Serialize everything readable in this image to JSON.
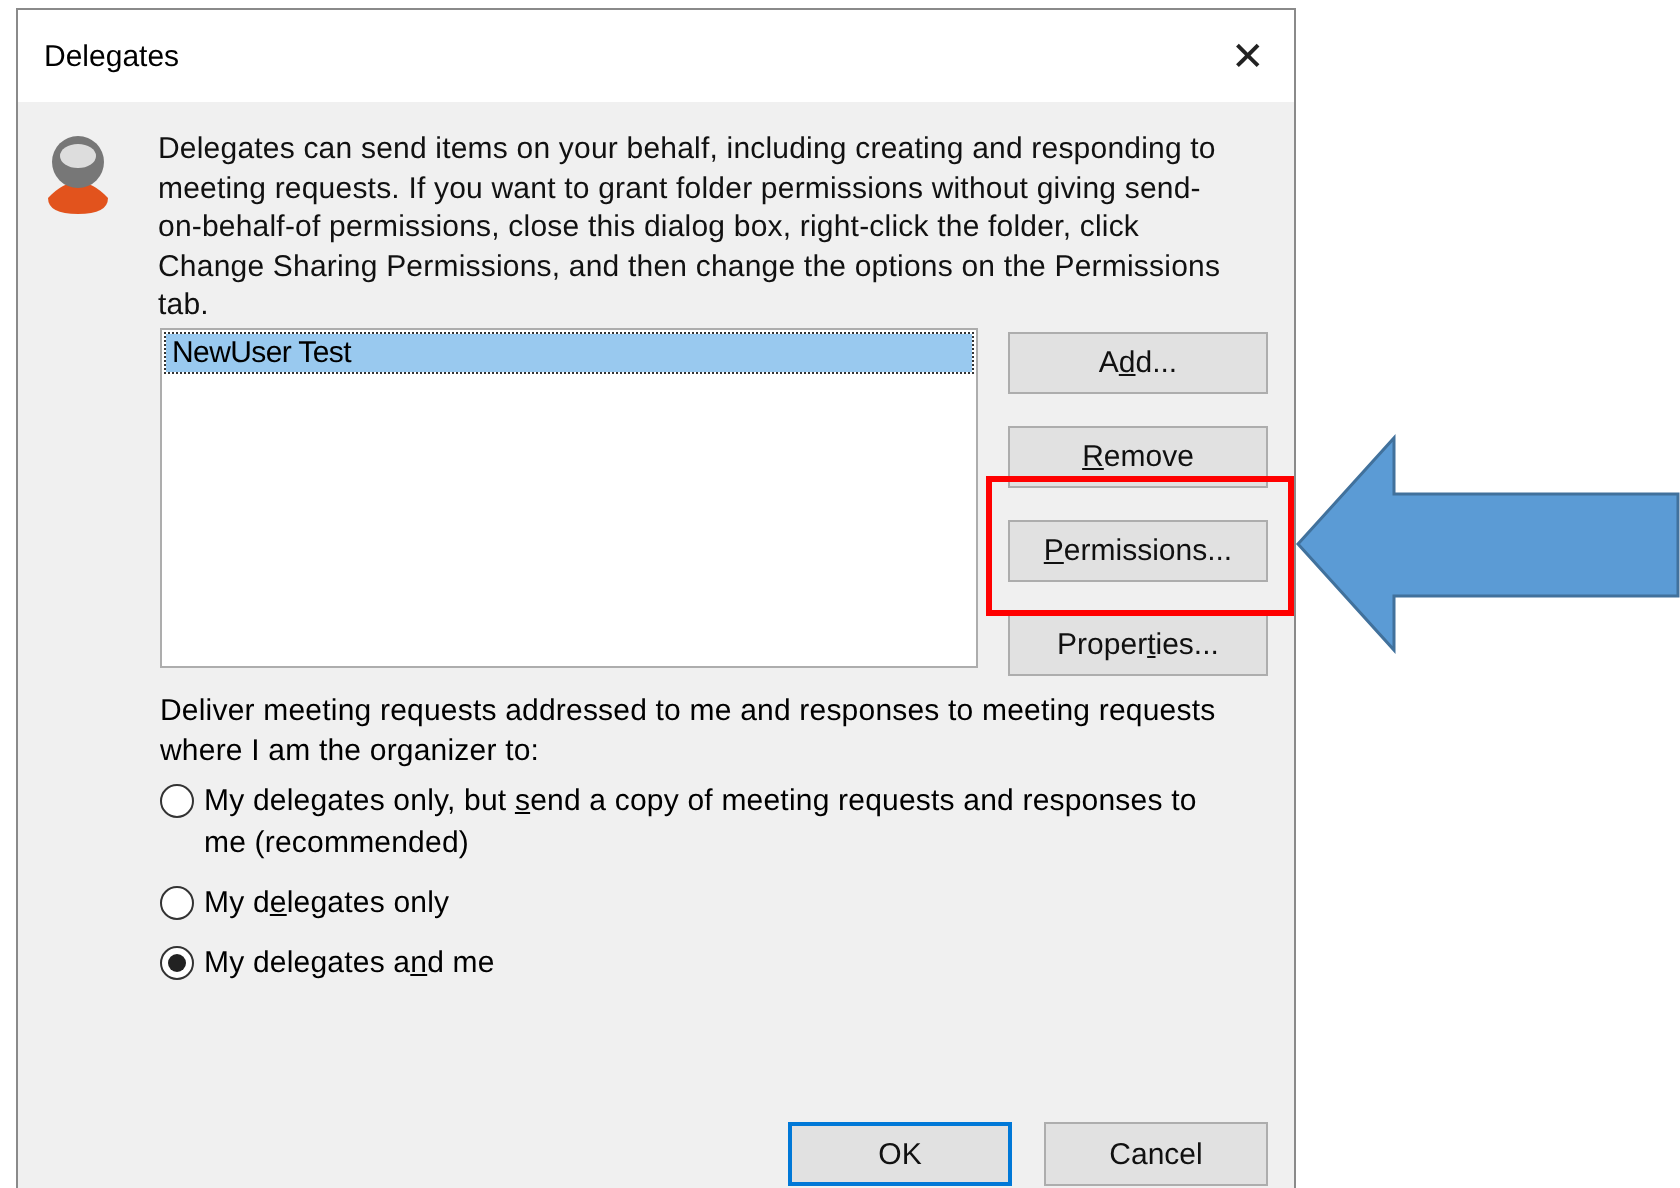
{
  "window": {
    "title": "Delegates",
    "close": "✕"
  },
  "intro": "Delegates can send items on your behalf, including creating and responding to meeting requests. If you want to grant folder permissions without giving send-on-behalf-of permissions, close this dialog box, right-click the folder, click Change Sharing Permissions, and then change the options on the Permissions tab.",
  "delegates": [
    {
      "name": "NewUser Test",
      "selected": true
    }
  ],
  "side_buttons": [
    {
      "label": {
        "before": "A",
        "key": "d",
        "after": "d..."
      }
    },
    {
      "label": {
        "key": "R",
        "after": "emove"
      }
    },
    {
      "label": {
        "key": "P",
        "after": "ermissions..."
      }
    },
    {
      "label": {
        "before": "Proper",
        "key": "t",
        "after": "ies..."
      }
    }
  ],
  "deliver_label": "Deliver meeting requests addressed to me and responses to meeting requests where I am the organizer to:",
  "options": [
    {
      "label": {
        "before": "My delegates only, but ",
        "key": "s",
        "after": "end a copy of meeting requests and responses to me (recommended)"
      },
      "selected": false
    },
    {
      "label": {
        "before": "My d",
        "key": "e",
        "after": "legates only"
      },
      "selected": false
    },
    {
      "label": {
        "before": "My delegates a",
        "key": "n",
        "after": "d me"
      },
      "selected": true
    }
  ],
  "footer_buttons": [
    {
      "label": "OK",
      "default": true
    },
    {
      "label": "Cancel",
      "default": false
    }
  ]
}
